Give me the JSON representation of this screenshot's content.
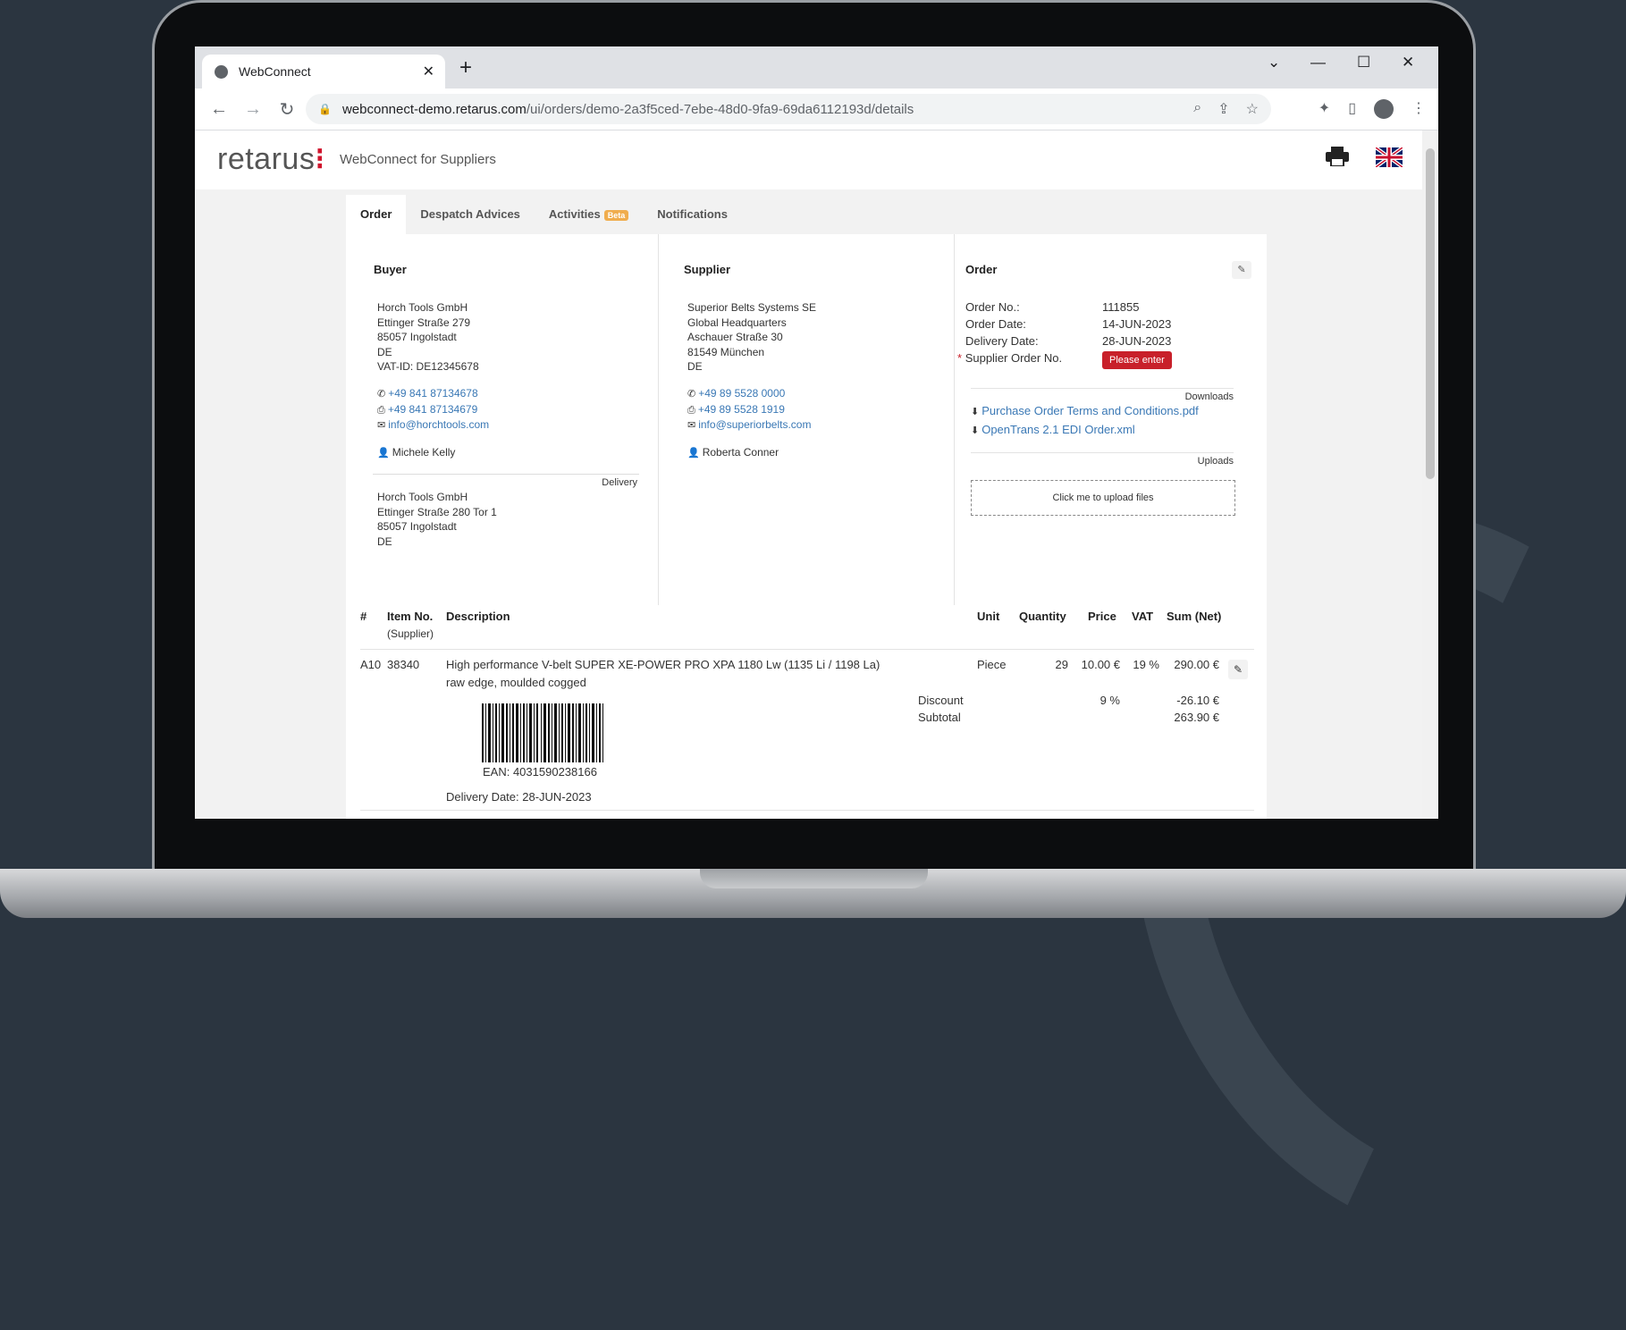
{
  "browser": {
    "tab_title": "WebConnect",
    "url_host": "webconnect-demo.retarus.com",
    "url_path": "/ui/orders/demo-2a3f5ced-7ebe-48d0-9fa9-69da6112193d/details"
  },
  "header": {
    "logo": "retarus",
    "subtitle": "WebConnect for Suppliers"
  },
  "tabs": [
    {
      "label": "Order"
    },
    {
      "label": "Despatch Advices"
    },
    {
      "label": "Activities",
      "badge": "Beta"
    },
    {
      "label": "Notifications"
    }
  ],
  "buyer": {
    "heading": "Buyer",
    "name": "Horch Tools GmbH",
    "street": "Ettinger Straße 279",
    "city": "85057 Ingolstadt",
    "country": "DE",
    "vat": "VAT-ID: DE12345678",
    "phone": "+49 841 87134678",
    "fax": "+49 841 87134679",
    "email": "info@horchtools.com",
    "contact": "Michele Kelly",
    "delivery_label": "Delivery",
    "delivery": {
      "name": "Horch Tools GmbH",
      "street": "Ettinger Straße 280 Tor 1",
      "city": "85057 Ingolstadt",
      "country": "DE"
    }
  },
  "supplier": {
    "heading": "Supplier",
    "name": "Superior Belts Systems SE",
    "line2": "Global Headquarters",
    "street": "Aschauer Straße 30",
    "city": "81549 München",
    "country": "DE",
    "phone": "+49 89 5528 0000",
    "fax": "+49 89 5528 1919",
    "email": "info@superiorbelts.com",
    "contact": "Roberta Conner"
  },
  "order": {
    "heading": "Order",
    "order_no_label": "Order No.:",
    "order_no": "111855",
    "order_date_label": "Order Date:",
    "order_date": "14-JUN-2023",
    "delivery_date_label": "Delivery Date:",
    "delivery_date": "28-JUN-2023",
    "supplier_order_label": "Supplier Order No.",
    "required_mark": "*",
    "please_enter": "Please enter",
    "downloads_label": "Downloads",
    "downloads": [
      "Purchase Order Terms and Conditions.pdf",
      "OpenTrans 2.1 EDI Order.xml"
    ],
    "uploads_label": "Uploads",
    "upload_prompt": "Click me to upload files"
  },
  "items_table": {
    "headers": {
      "pos": "#",
      "item_no": "Item No.",
      "item_no_sub": "(Supplier)",
      "description": "Description",
      "unit": "Unit",
      "quantity": "Quantity",
      "price": "Price",
      "vat": "VAT",
      "sum": "Sum (Net)"
    },
    "row": {
      "pos": "A10",
      "item_no": "38340",
      "description_1": "High performance V-belt SUPER XE-POWER PRO XPA 1180 Lw (1135 Li / 1198 La)",
      "description_2": "raw edge, moulded cogged",
      "unit": "Piece",
      "quantity": "29",
      "price": "10.00 €",
      "vat": "19 %",
      "sum": "290.00 €",
      "discount_label": "Discount",
      "discount_pct": "9 %",
      "discount_value": "-26.10 €",
      "subtotal_label": "Subtotal",
      "subtotal_value": "263.90 €",
      "ean": "EAN: 4031590238166",
      "delivery_date": "Delivery Date: 28-JUN-2023"
    }
  }
}
